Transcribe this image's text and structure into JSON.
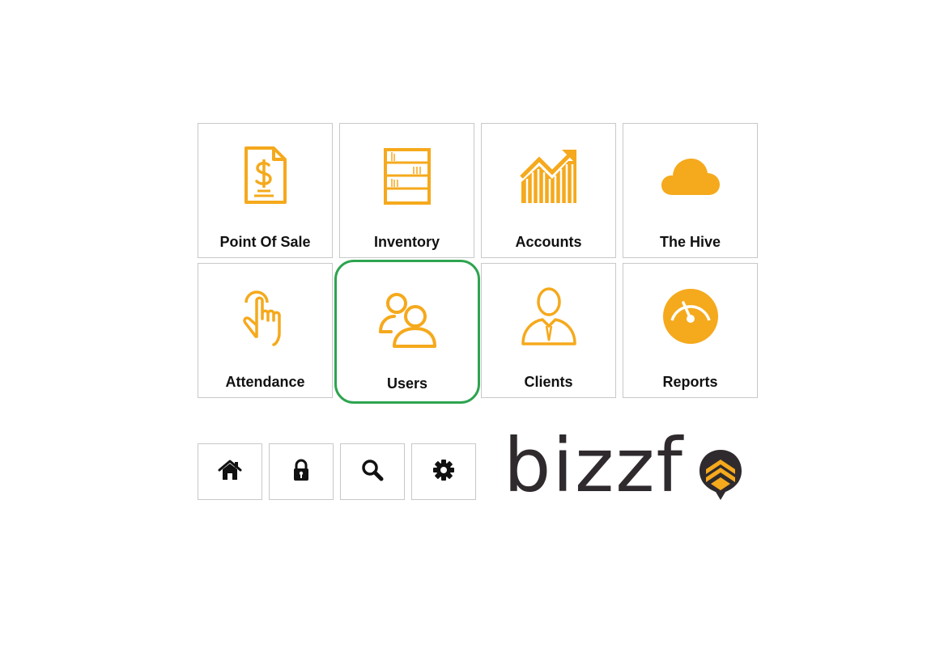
{
  "tiles": [
    {
      "label": "Point Of Sale",
      "icon": "receipt-dollar-icon"
    },
    {
      "label": "Inventory",
      "icon": "bookshelf-icon"
    },
    {
      "label": "Accounts",
      "icon": "growth-chart-icon"
    },
    {
      "label": "The Hive",
      "icon": "cloud-icon"
    },
    {
      "label": "Attendance",
      "icon": "tap-hand-icon"
    },
    {
      "label": "Users",
      "icon": "users-icon"
    },
    {
      "label": "Clients",
      "icon": "businessman-icon"
    },
    {
      "label": "Reports",
      "icon": "gauge-icon"
    }
  ],
  "selected_tile": "Users",
  "toolbar": [
    {
      "name": "home",
      "icon": "home-icon"
    },
    {
      "name": "lock",
      "icon": "lock-icon"
    },
    {
      "name": "search",
      "icon": "search-icon"
    },
    {
      "name": "settings",
      "icon": "gear-icon"
    }
  ],
  "logo": {
    "text": "bizzf",
    "mark": "bee-shield-icon"
  },
  "colors": {
    "accent": "#f5a91c",
    "selected_outline": "#2ea44f",
    "tile_border": "#c8c8c8",
    "label": "#111111",
    "logo_text": "#2f2a2d"
  }
}
